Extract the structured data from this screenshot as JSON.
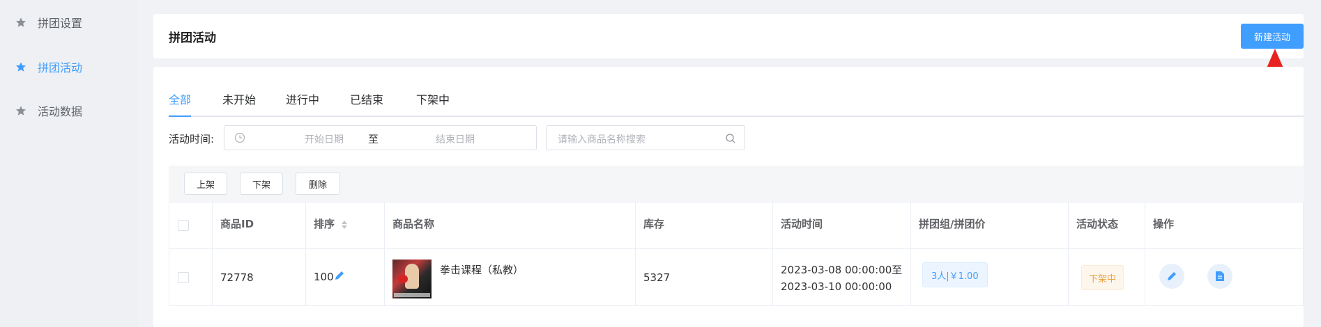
{
  "sidebar": {
    "items": [
      {
        "label": "拼团设置",
        "active": false
      },
      {
        "label": "拼团活动",
        "active": true
      },
      {
        "label": "活动数据",
        "active": false
      }
    ]
  },
  "header": {
    "title": "拼团活动",
    "new_button": "新建活动"
  },
  "tabs": [
    "全部",
    "未开始",
    "进行中",
    "已结束",
    "下架中"
  ],
  "active_tab": "全部",
  "filter": {
    "label": "活动时间:",
    "start_placeholder": "开始日期",
    "separator": "至",
    "end_placeholder": "结束日期",
    "search_placeholder": "请输入商品名称搜索"
  },
  "toolbar": {
    "online": "上架",
    "offline": "下架",
    "delete": "删除"
  },
  "table": {
    "columns": [
      "商品ID",
      "排序",
      "商品名称",
      "库存",
      "活动时间",
      "拼团组/拼团价",
      "活动状态",
      "操作"
    ],
    "rows": [
      {
        "id": "72778",
        "sort": "100",
        "name": "拳击课程（私教）",
        "stock": "5327",
        "time_start": "2023-03-08 00:00:00至",
        "time_end": "2023-03-10 00:00:00",
        "group_price": "3人|￥1.00",
        "status": "下架中"
      }
    ]
  },
  "colors": {
    "accent": "#409eff",
    "annotation_arrow": "#e8231f",
    "status_offline": "#e6a23c"
  },
  "icons": [
    "star-icon",
    "clock-icon",
    "search-icon",
    "sort-icon",
    "edit-icon",
    "document-icon"
  ]
}
